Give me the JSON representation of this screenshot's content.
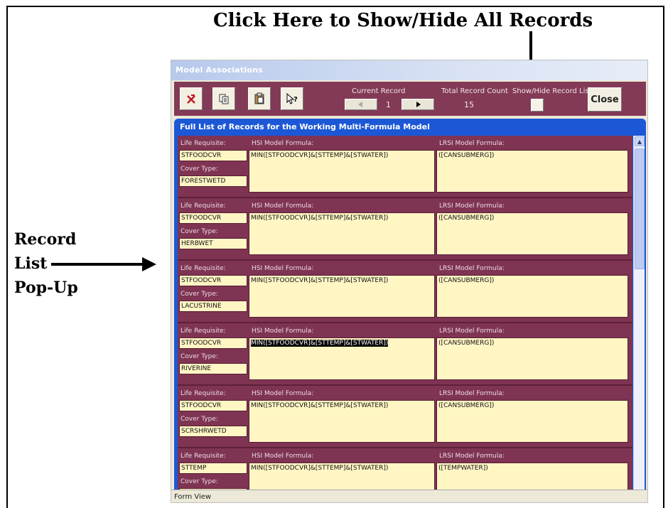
{
  "annotations": {
    "title": "Click Here to Show/Hide All Records",
    "side_line1": "Record",
    "side_line2": "List",
    "side_line3": "Pop-Up"
  },
  "window": {
    "title": "Model Associations",
    "status": "Form View"
  },
  "toolbar": {
    "current_record_label": "Current Record",
    "current_record_value": "1",
    "total_label": "Total Record Count",
    "total_value": "15",
    "show_hide_label": "Show/Hide Record List",
    "close_label": "Close",
    "buttons": [
      "delete-record-icon",
      "copy-icon",
      "paste-icon",
      "help-icon"
    ]
  },
  "popup": {
    "title": "Full List of Records for the Working Multi-Formula Model",
    "labels": {
      "life_requisite": "Life Requisite:",
      "cover_type": "Cover Type:",
      "hsi_formula": "HSI Model Formula:",
      "lrsi_formula": "LRSI Model Formula:"
    },
    "records": [
      {
        "life_requisite": "STFOODCVR",
        "cover_type": "FORESTWETD",
        "hsi": "MIN([STFOODCVR]&[STTEMP]&[STWATER])",
        "lrsi": "([CANSUBMERG])"
      },
      {
        "life_requisite": "STFOODCVR",
        "cover_type": "HERBWET",
        "hsi": "MIN([STFOODCVR]&[STTEMP]&[STWATER])",
        "lrsi": "([CANSUBMERG])"
      },
      {
        "life_requisite": "STFOODCVR",
        "cover_type": "LACUSTRINE",
        "hsi": "MIN([STFOODCVR]&[STTEMP]&[STWATER])",
        "lrsi": "([CANSUBMERG])"
      },
      {
        "life_requisite": "STFOODCVR",
        "cover_type": "RIVERINE",
        "hsi": "MIN([STFOODCVR]&[STTEMP]&[STWATER])",
        "lrsi": "([CANSUBMERG])"
      },
      {
        "life_requisite": "STFOODCVR",
        "cover_type": "SCRSHRWETD",
        "hsi": "MIN([STFOODCVR]&[STTEMP]&[STWATER])",
        "lrsi": "([CANSUBMERG])"
      },
      {
        "life_requisite": "STTEMP",
        "cover_type": "",
        "hsi": "MIN([STFOODCVR]&[STTEMP]&[STWATER])",
        "lrsi": "([TEMPWATER])"
      }
    ]
  }
}
